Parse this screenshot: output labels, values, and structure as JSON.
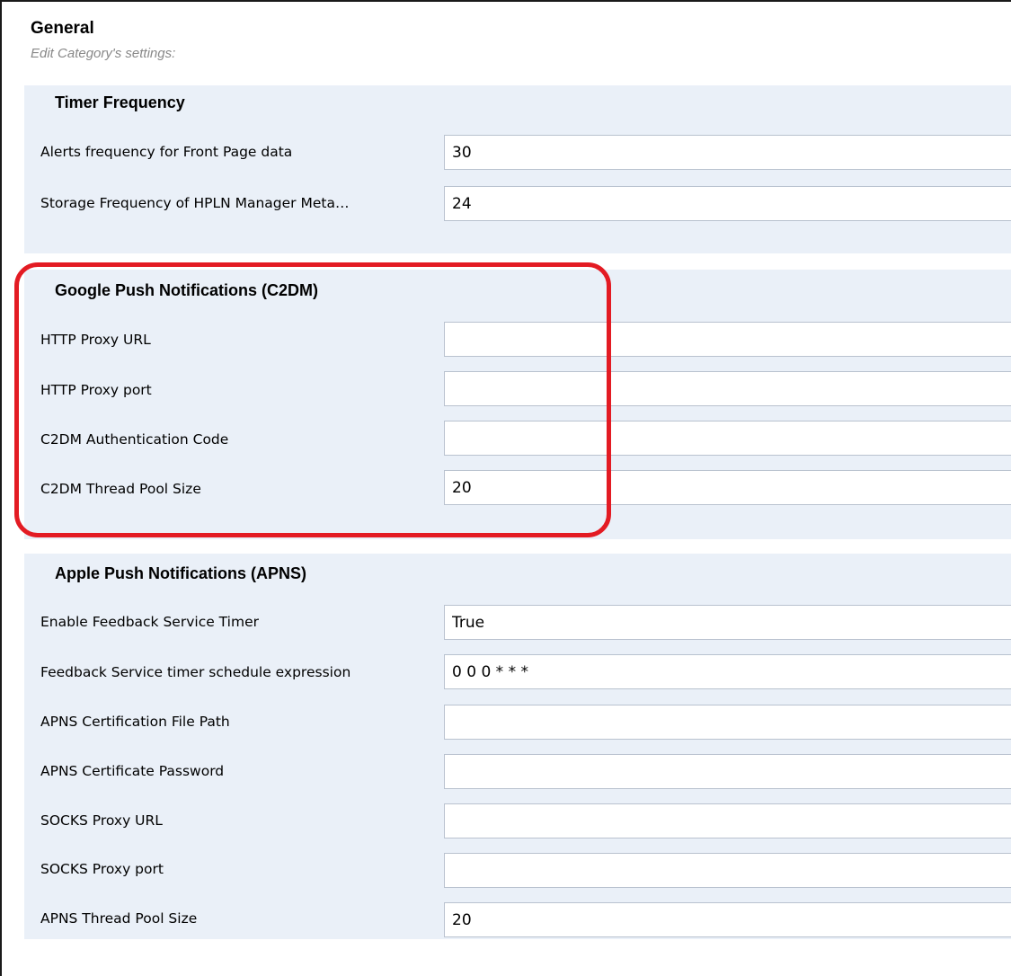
{
  "header": {
    "title": "General",
    "subtitle": "Edit Category's settings:"
  },
  "sections": [
    {
      "title": "Timer Frequency",
      "fields": [
        {
          "label": "Alerts frequency for Front Page data",
          "value": "30"
        },
        {
          "label": "Storage Frequency of HPLN Manager Meta…",
          "value": "24"
        }
      ]
    },
    {
      "title": "Google Push Notifications (C2DM)",
      "fields": [
        {
          "label": "HTTP Proxy URL",
          "value": ""
        },
        {
          "label": "HTTP Proxy port",
          "value": ""
        },
        {
          "label": "C2DM Authentication Code",
          "value": ""
        },
        {
          "label": "C2DM Thread Pool Size",
          "value": "20"
        }
      ]
    },
    {
      "title": "Apple Push Notifications (APNS)",
      "fields": [
        {
          "label": "Enable Feedback Service Timer",
          "value": "True"
        },
        {
          "label": "Feedback Service timer schedule expression",
          "value": "0 0 0 * * *"
        },
        {
          "label": "APNS Certification File Path",
          "value": ""
        },
        {
          "label": "APNS Certificate Password",
          "value": ""
        },
        {
          "label": "SOCKS Proxy URL",
          "value": ""
        },
        {
          "label": "SOCKS Proxy port",
          "value": ""
        },
        {
          "label": "APNS Thread Pool Size",
          "value": "20"
        }
      ]
    }
  ],
  "colors": {
    "section_background": "#eaf0f8",
    "highlight_annotation": "#e31b23",
    "subtitle_text": "#888888"
  }
}
